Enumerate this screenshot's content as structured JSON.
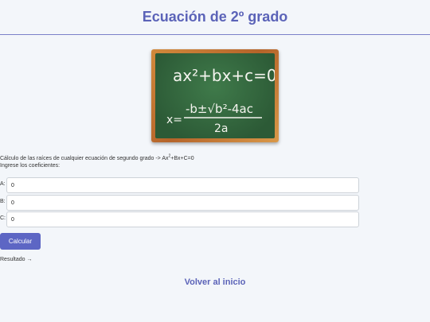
{
  "header": {
    "title": "Ecuación de 2º grado"
  },
  "board": {
    "line1": "ax²+bx+c=0",
    "prefix": "x=",
    "numerator": "-b±√b²-4ac",
    "denominator": "2a"
  },
  "description": {
    "line1_text": "Cálculo de las raíces de cualquier ecuación de segundo grado -> Ax",
    "line1_sup": "2",
    "line1_tail": "+Bx+C=0",
    "line2": "Ingrese los coeficientes:"
  },
  "fields": [
    {
      "label": "A:",
      "value": "0"
    },
    {
      "label": "B:",
      "value": "0"
    },
    {
      "label": "C:",
      "value": "0"
    }
  ],
  "calculate_label": "Calcular",
  "result_label": "Resultado →",
  "back_label": "Volver al inicio"
}
